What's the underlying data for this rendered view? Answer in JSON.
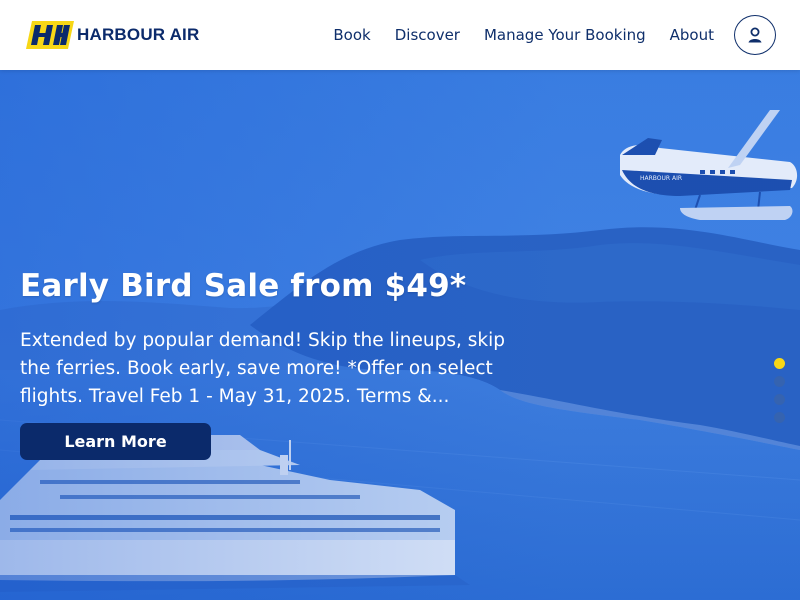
{
  "brand": {
    "name": "HARBOUR AIR",
    "logo_letters": "HA",
    "primary": "#0b2a6b",
    "accent": "#f7d716"
  },
  "nav": {
    "items": [
      {
        "label": "Book"
      },
      {
        "label": "Discover"
      },
      {
        "label": "Manage Your Booking"
      },
      {
        "label": "About"
      }
    ],
    "account_icon": "user-icon"
  },
  "hero": {
    "title": "Early Bird Sale from $49*",
    "text": "Extended by popular demand! Skip the lineups, skip the ferries. Book early, save more! *Offer on select flights. Travel Feb 1 - May 31, 2025. Terms &...",
    "cta_label": "Learn More",
    "slides": {
      "count": 4,
      "active": 1
    },
    "plane_livery": "HARBOUR AIR"
  }
}
